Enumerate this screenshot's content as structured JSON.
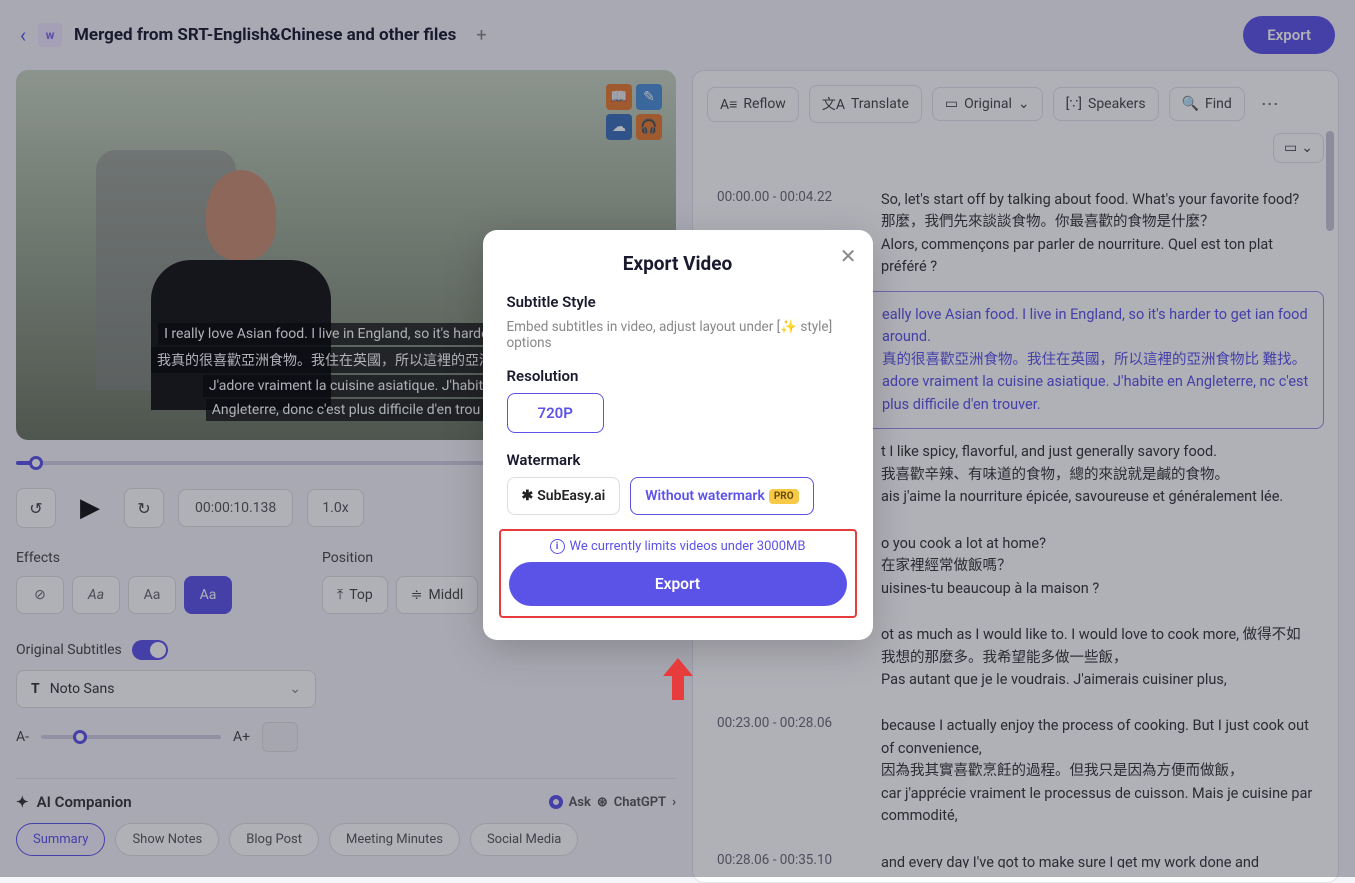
{
  "header": {
    "title": "Merged from SRT-English&Chinese and other files",
    "export": "Export"
  },
  "video": {
    "caption_en": "I really love Asian food. I live in England, so it's harder to ge",
    "caption_zh": "我真的很喜歡亞洲食物。我住在英國，所以這裡的亞洲食物比",
    "caption_fr1": "J'adore vraiment la cuisine asiatique. J'habit",
    "caption_fr2": "Angleterre, donc c'est plus difficile d'en trou"
  },
  "controls": {
    "timestamp": "00:00:10.138",
    "rate": "1.0x"
  },
  "effects": {
    "title": "Effects",
    "options": [
      "⊘",
      "Aa",
      "Aa",
      "Aa"
    ]
  },
  "position": {
    "title": "Position",
    "top": "Top",
    "middle": "Middl"
  },
  "subtitles": {
    "label": "Original Subtitles",
    "font": "Noto Sans",
    "size_minus": "A-",
    "size_plus": "A+"
  },
  "companion": {
    "title": "AI Companion",
    "ask": "Ask",
    "gpt": "ChatGPT",
    "chips": [
      "Summary",
      "Show Notes",
      "Blog Post",
      "Meeting Minutes",
      "Social Media"
    ]
  },
  "toolbar": {
    "reflow": "Reflow",
    "translate": "Translate",
    "original": "Original",
    "speakers": "Speakers",
    "find": "Find"
  },
  "segments": [
    {
      "time": "00:00.00 - 00:04.22",
      "lines": [
        "So, let's start off by talking about food. What's your favorite food?",
        "那麼，我們先來談談食物。你最喜歡的食物是什麼？",
        "Alors, commençons par parler de nourriture. Quel est ton plat préféré ?"
      ],
      "selected": false
    },
    {
      "time": "",
      "lines": [
        "eally love Asian food. I live in England, so it's harder to get ian food around.",
        "真的很喜歡亞洲食物。我住在英國，所以這裡的亞洲食物比 難找。",
        "adore vraiment la cuisine asiatique. J'habite en Angleterre, nc c'est plus difficile d'en trouver."
      ],
      "selected": true
    },
    {
      "time": "",
      "lines": [
        "t I like spicy, flavorful, and just generally savory food.",
        "我喜歡辛辣、有味道的食物，總的來說就是鹹的食物。",
        "ais j'aime la nourriture épicée, savoureuse et généralement lée."
      ],
      "selected": false
    },
    {
      "time": "",
      "lines": [
        "o you cook a lot at home?",
        "在家裡經常做飯嗎？",
        "uisines-tu beaucoup à la maison ?"
      ],
      "selected": false
    },
    {
      "time": "",
      "lines": [
        "ot as much as I would like to. I would love to cook more, 做得不如我想的那麼多。我希望能多做一些飯，",
        "Pas autant que je le voudrais. J'aimerais cuisiner plus,"
      ],
      "selected": false
    },
    {
      "time": "00:23.00 - 00:28.06",
      "lines": [
        "because I actually enjoy the process of cooking. But I just cook out of convenience,",
        "因為我其實喜歡烹飪的過程。但我只是因為方便而做飯，",
        "car j'apprécie vraiment le processus de cuisson. Mais je cuisine par commodité,"
      ],
      "selected": false
    },
    {
      "time": "00:28.06 - 00:35.10",
      "lines": [
        "and every day I've got to make sure I get my work done and"
      ],
      "selected": false
    }
  ],
  "modal": {
    "title": "Export Video",
    "subtitle_style_label": "Subtitle Style",
    "subtitle_style_desc_pre": "Embed subtitles in video, adjust layout under [",
    "subtitle_style_desc_post": " style] options",
    "resolution_label": "Resolution",
    "resolution_value": "720P",
    "watermark_label": "Watermark",
    "wm_subeasy": "SubEasy.ai",
    "wm_without": "Without watermark",
    "wm_pro": "PRO",
    "limit_text": "We currently limits videos under 3000MB",
    "export_action": "Export"
  }
}
